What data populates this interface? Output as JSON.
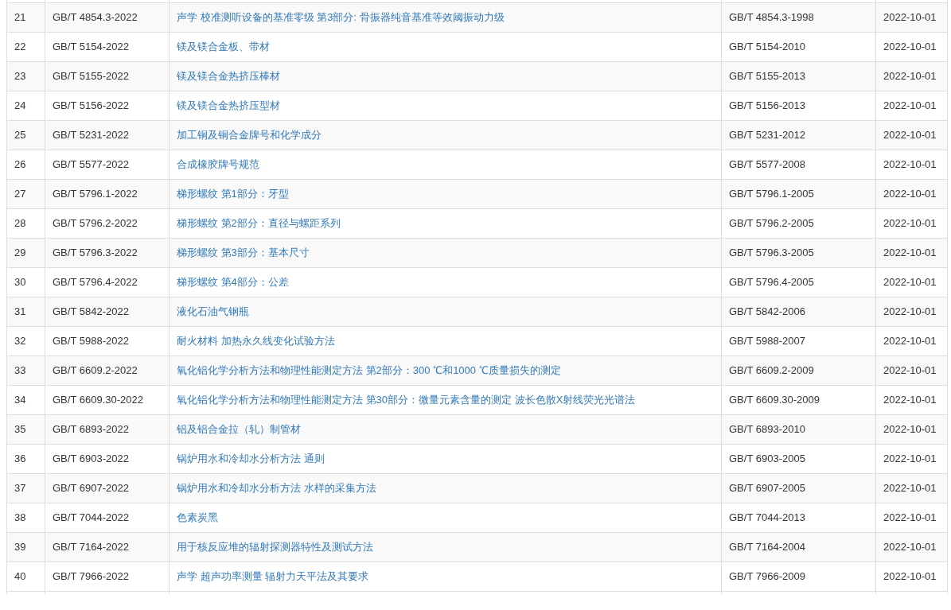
{
  "table": {
    "rows": [
      {
        "column_1": "21",
        "column_2": "GB/T 4854.3-2022",
        "column_3": "声学 校准测听设备的基准零级 第3部分: 骨振器纯音基准等效阈振动力级",
        "column_4": "GB/T 4854.3-1998",
        "column_5": "2022-10-01"
      },
      {
        "column_1": "22",
        "column_2": "GB/T 5154-2022",
        "column_3": "镁及镁合金板、带材",
        "column_4": "GB/T 5154-2010",
        "column_5": "2022-10-01"
      },
      {
        "column_1": "23",
        "column_2": "GB/T 5155-2022",
        "column_3": "镁及镁合金热挤压棒材",
        "column_4": "GB/T 5155-2013",
        "column_5": "2022-10-01"
      },
      {
        "column_1": "24",
        "column_2": "GB/T 5156-2022",
        "column_3": "镁及镁合金热挤压型材",
        "column_4": "GB/T 5156-2013",
        "column_5": "2022-10-01"
      },
      {
        "column_1": "25",
        "column_2": "GB/T 5231-2022",
        "column_3": "加工铜及铜合金牌号和化学成分",
        "column_4": "GB/T 5231-2012",
        "column_5": "2022-10-01"
      },
      {
        "column_1": "26",
        "column_2": "GB/T 5577-2022",
        "column_3": "合成橡胶牌号规范",
        "column_4": "GB/T 5577-2008",
        "column_5": "2022-10-01"
      },
      {
        "column_1": "27",
        "column_2": "GB/T 5796.1-2022",
        "column_3": "梯形螺纹 第1部分：牙型",
        "column_4": "GB/T 5796.1-2005",
        "column_5": "2022-10-01"
      },
      {
        "column_1": "28",
        "column_2": "GB/T 5796.2-2022",
        "column_3": "梯形螺纹 第2部分：直径与螺距系列",
        "column_4": "GB/T 5796.2-2005",
        "column_5": "2022-10-01"
      },
      {
        "column_1": "29",
        "column_2": "GB/T 5796.3-2022",
        "column_3": "梯形螺纹 第3部分：基本尺寸",
        "column_4": "GB/T 5796.3-2005",
        "column_5": "2022-10-01"
      },
      {
        "column_1": "30",
        "column_2": "GB/T 5796.4-2022",
        "column_3": "梯形螺纹 第4部分：公差",
        "column_4": "GB/T 5796.4-2005",
        "column_5": "2022-10-01"
      },
      {
        "column_1": "31",
        "column_2": "GB/T 5842-2022",
        "column_3": "液化石油气钢瓶",
        "column_4": "GB/T 5842-2006",
        "column_5": "2022-10-01"
      },
      {
        "column_1": "32",
        "column_2": "GB/T 5988-2022",
        "column_3": "耐火材料 加热永久线变化试验方法",
        "column_4": "GB/T 5988-2007",
        "column_5": "2022-10-01"
      },
      {
        "column_1": "33",
        "column_2": "GB/T 6609.2-2022",
        "column_3": "氧化铝化学分析方法和物理性能测定方法 第2部分：300 ℃和1000 ℃质量损失的测定",
        "column_4": "GB/T 6609.2-2009",
        "column_5": "2022-10-01"
      },
      {
        "column_1": "34",
        "column_2": "GB/T 6609.30-2022",
        "column_3": "氧化铝化学分析方法和物理性能测定方法 第30部分：微量元素含量的测定 波长色散X射线荧光光谱法",
        "column_4": "GB/T 6609.30-2009",
        "column_5": "2022-10-01"
      },
      {
        "column_1": "35",
        "column_2": "GB/T 6893-2022",
        "column_3": "铝及铝合金拉（轧）制管材",
        "column_4": "GB/T 6893-2010",
        "column_5": "2022-10-01"
      },
      {
        "column_1": "36",
        "column_2": "GB/T 6903-2022",
        "column_3": "锅炉用水和冷却水分析方法 通则",
        "column_4": "GB/T 6903-2005",
        "column_5": "2022-10-01"
      },
      {
        "column_1": "37",
        "column_2": "GB/T 6907-2022",
        "column_3": "锅炉用水和冷却水分析方法 水样的采集方法",
        "column_4": "GB/T 6907-2005",
        "column_5": "2022-10-01"
      },
      {
        "column_1": "38",
        "column_2": "GB/T 7044-2022",
        "column_3": "色素炭黑",
        "column_4": "GB/T 7044-2013",
        "column_5": "2022-10-01"
      },
      {
        "column_1": "39",
        "column_2": "GB/T 7164-2022",
        "column_3": "用于核反应堆的辐射探测器特性及测试方法",
        "column_4": "GB/T 7164-2004",
        "column_5": "2022-10-01"
      },
      {
        "column_1": "40",
        "column_2": "GB/T 7966-2022",
        "column_3": "声学 超声功率测量 辐射力天平法及其要求",
        "column_4": "GB/T 7966-2009",
        "column_5": "2022-10-01"
      }
    ]
  }
}
